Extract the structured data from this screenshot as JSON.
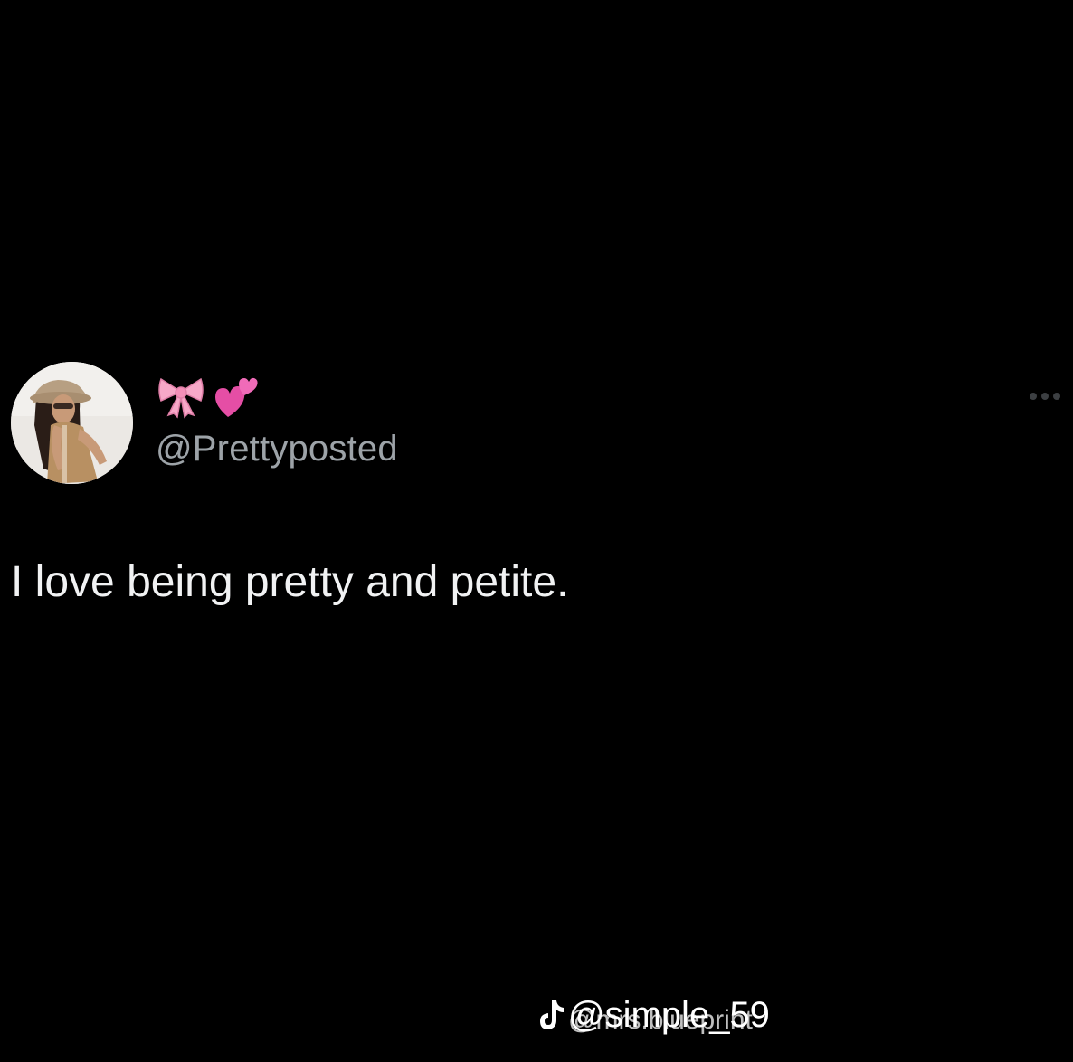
{
  "tweet": {
    "display_name_emojis": [
      "ribbon-icon",
      "two-hearts-icon"
    ],
    "handle": "@Prettyposted",
    "text": "I love being pretty and petite.",
    "more_options_icon": "ellipsis-icon"
  },
  "watermark": {
    "icon": "tiktok-icon",
    "primary": "@simple_59",
    "secondary": "@mrs.blueprint"
  },
  "colors": {
    "background": "#000000",
    "text": "#f1f2f3",
    "handle": "#9da3a8",
    "ribbon": "#f7a8c8",
    "hearts": "#e54ea5"
  }
}
